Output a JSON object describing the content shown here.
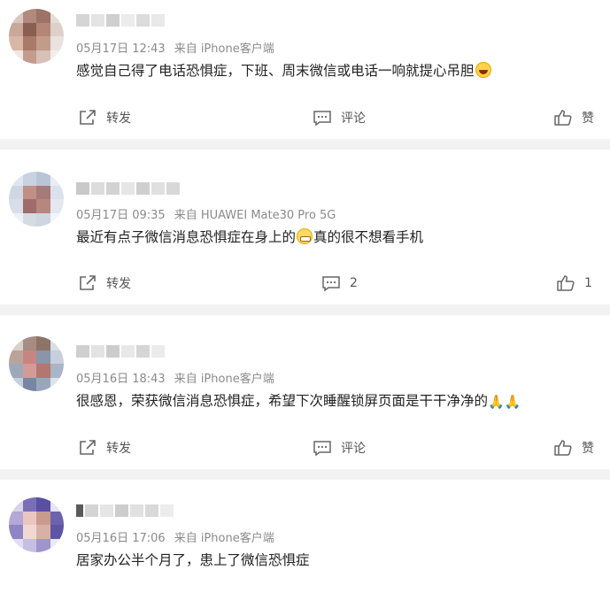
{
  "posts": [
    {
      "meta": {
        "date": "05月17日 12:43",
        "source": "来自 iPhone客户端"
      },
      "text": "感觉自己得了电话恐惧症，下班、周末微信或电话一响就提心吊胆",
      "actions": {
        "forward": "转发",
        "comment": "评论",
        "like": "赞"
      }
    },
    {
      "meta": {
        "date": "05月17日 09:35",
        "source": "来自 HUAWEI Mate30 Pro 5G"
      },
      "text_before": "最近有点子微信消息恐惧症在身上的",
      "text_after": "真的很不想看手机",
      "actions": {
        "forward": "转发",
        "comment": "2",
        "like": "1"
      }
    },
    {
      "meta": {
        "date": "05月16日 18:43",
        "source": "来自 iPhone客户端"
      },
      "text": "很感恩，荣获微信消息恐惧症，希望下次睡醒锁屏页面是干干净净的",
      "emoji": "🙏🙏",
      "actions": {
        "forward": "转发",
        "comment": "评论",
        "like": "赞"
      }
    },
    {
      "meta": {
        "date": "05月16日 17:06",
        "source": "来自 iPhone客户端"
      },
      "text": "居家办公半个月了，患上了微信恐惧症"
    }
  ],
  "icons": {
    "forward": "share-arrow-icon",
    "comment": "comment-bubble-icon",
    "like": "thumbs-up-icon",
    "emoji_post1": "laughing-tears-emoji",
    "emoji_post2": "grinning-emoji"
  },
  "colors": {
    "page_bg": "#f2f2f2",
    "card_bg": "#ffffff",
    "meta_text": "#8a8a8a",
    "body_text": "#222222",
    "action_text": "#555555"
  }
}
